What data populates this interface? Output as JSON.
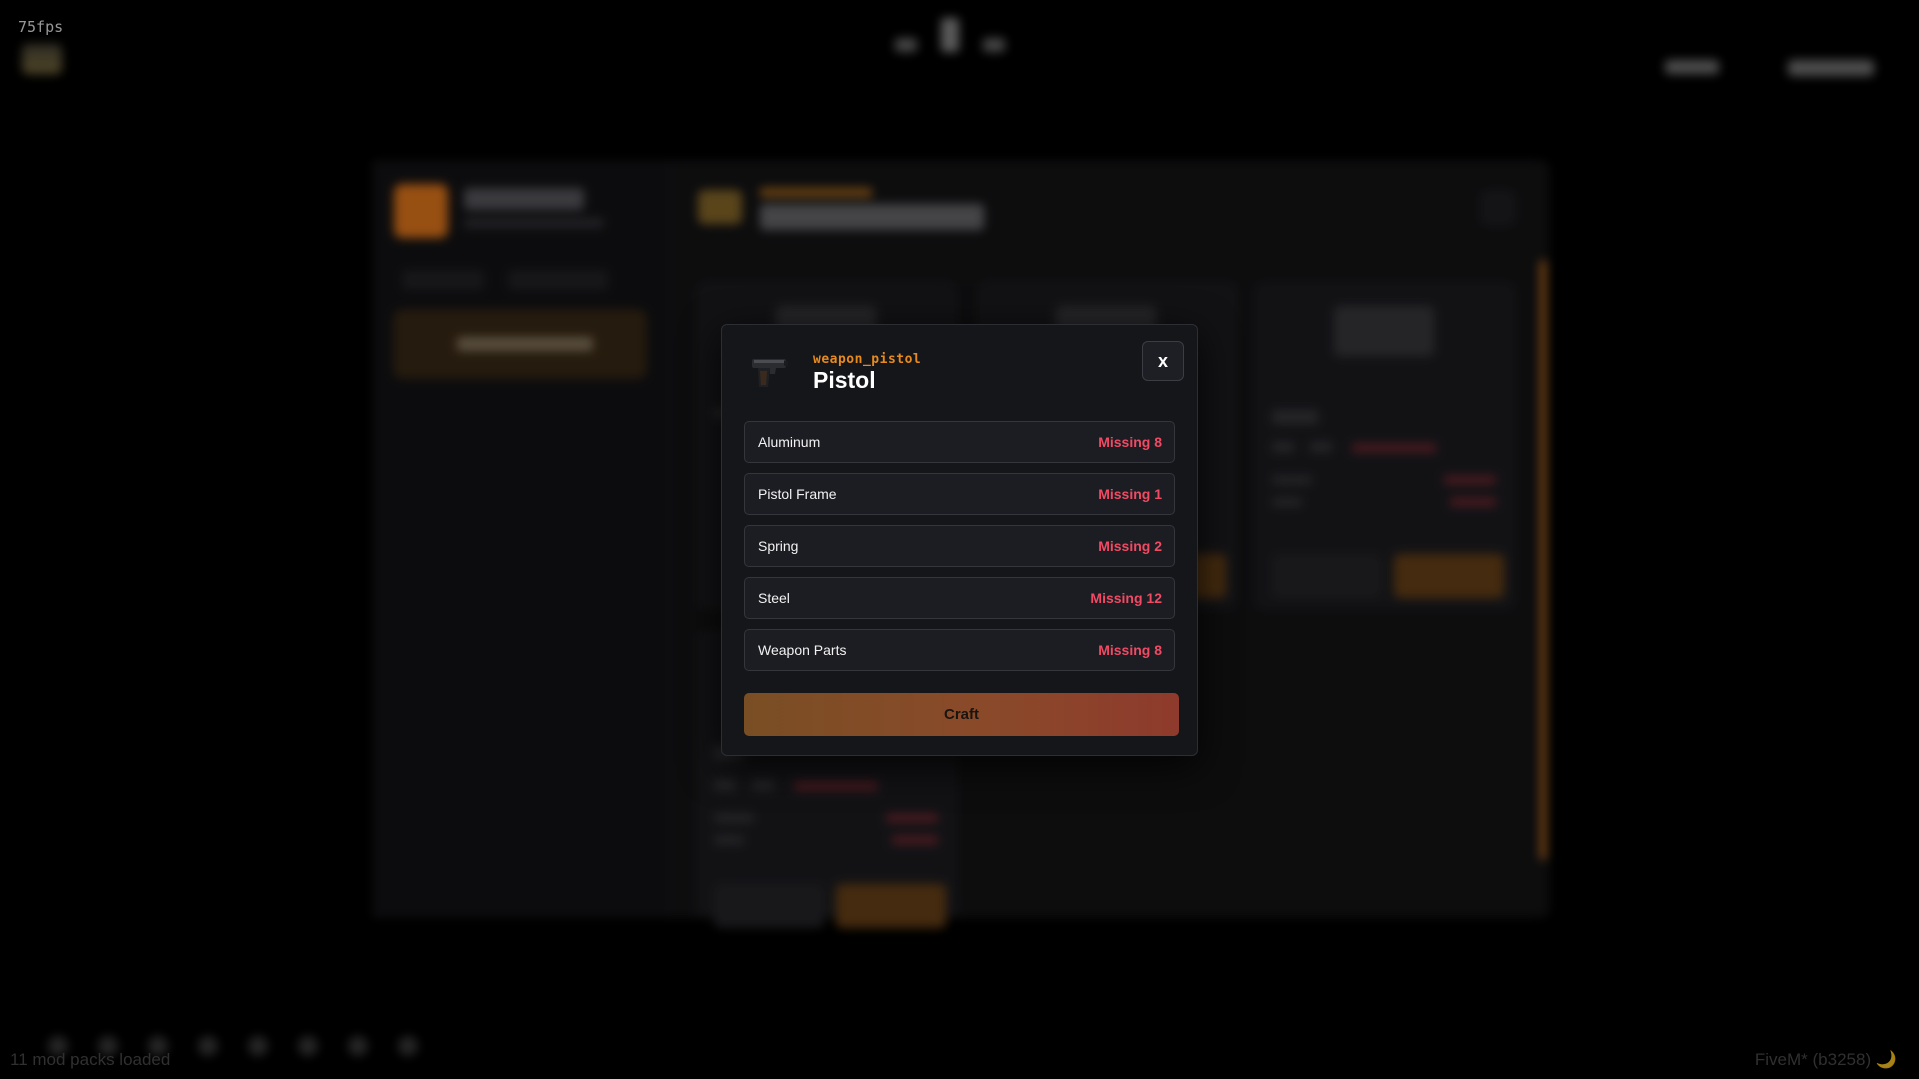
{
  "hud": {
    "fps": "75fps",
    "mods_loaded": "11 mod packs loaded",
    "version": "FiveM* (b3258) 🌙"
  },
  "modal": {
    "item_id": "weapon_pistol",
    "item_name": "Pistol",
    "close_label": "x",
    "requirements": [
      {
        "name": "Aluminum",
        "status": "Missing 8"
      },
      {
        "name": "Pistol Frame",
        "status": "Missing 1"
      },
      {
        "name": "Spring",
        "status": "Missing 2"
      },
      {
        "name": "Steel",
        "status": "Missing 12"
      },
      {
        "name": "Weapon Parts",
        "status": "Missing 8"
      }
    ],
    "craft_label": "Craft"
  },
  "colors": {
    "accent": "#e88a1e",
    "missing": "#f04a64",
    "modal_bg": "#15161a"
  },
  "icons": {
    "modal_item": "pistol-icon"
  }
}
